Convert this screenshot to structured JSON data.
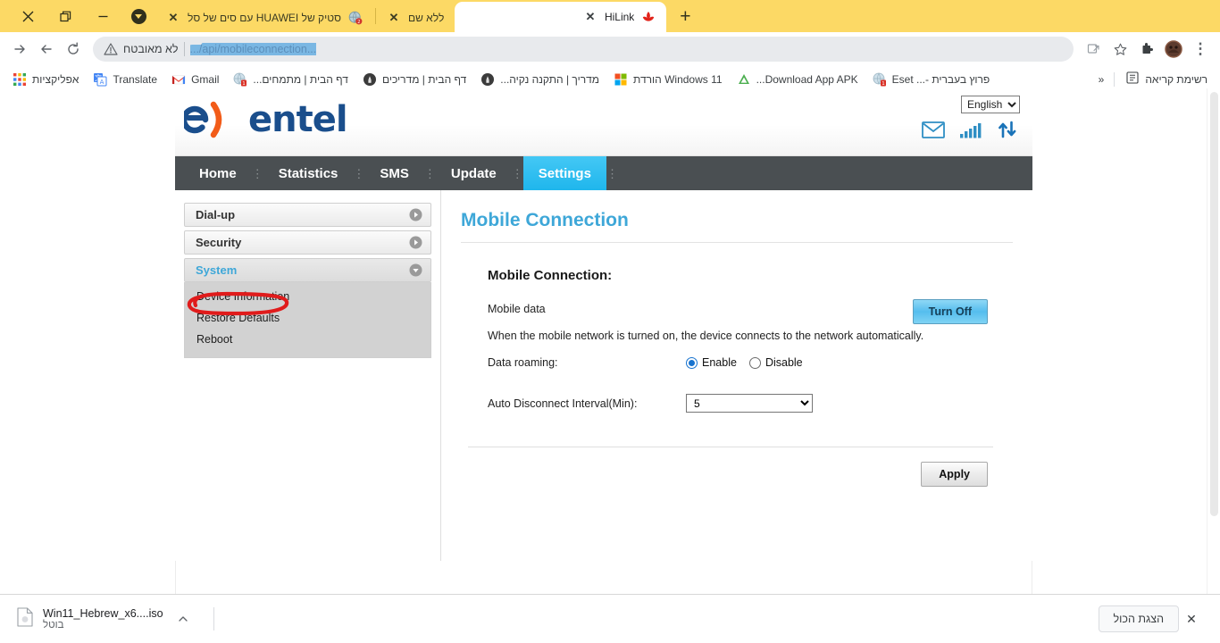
{
  "browser": {
    "window_controls": [
      {
        "name": "close-window",
        "glyph": "close"
      },
      {
        "name": "restore-window",
        "glyph": "restore"
      },
      {
        "name": "minimize-window",
        "glyph": "minimize"
      }
    ],
    "tab_search_label": "",
    "new_tab_label": "+",
    "tabs": [
      {
        "title": "HiLink",
        "active": true,
        "favicon": "huawei-petal-icon",
        "close_label": "✕"
      },
      {
        "title": "ללא שם",
        "active": false,
        "favicon": "none",
        "close_label": "✕"
      },
      {
        "title": "סטיק של HUAWEI עם סים של סל",
        "active": false,
        "favicon": "globe-badge-icon",
        "close_label": "✕"
      }
    ],
    "toolbar": {
      "forward_label": "→",
      "back_label": "←",
      "reload_label": "↻",
      "security_text": "לא מאובטח",
      "url": ".../api/mobileconnection...",
      "url_redacted": true,
      "bookmark_star": "☆",
      "extensions_label": "",
      "profile_label": "",
      "menu_label": "⋮"
    },
    "bookmarks": {
      "apps_label": "אפליקציות",
      "items": [
        {
          "label": "Translate",
          "icon": "translate-icon"
        },
        {
          "label": "Gmail",
          "icon": "gmail-icon"
        },
        {
          "label": "דף הבית | מתמחים...",
          "icon": "red-doc-icon"
        },
        {
          "label": "דף הבית | מדריכים",
          "icon": "dark-badge-icon"
        },
        {
          "label": "מדריך | התקנה נקיה...",
          "icon": "dark-badge-icon"
        },
        {
          "label": "Windows 11 הורדת",
          "icon": "windows-icon"
        },
        {
          "label": "Download App APK...",
          "icon": "apkpure-icon"
        },
        {
          "label": "פרוץ בעברית -... Eset",
          "icon": "red-doc-icon"
        }
      ],
      "overflow_label": "«",
      "reading_list_label": "רשימת קריאה"
    },
    "download_shelf": {
      "file_name": "Win11_Hebrew_x6....iso",
      "status": "בוטל",
      "file_icon": "document-icon",
      "expand_label": "∧",
      "show_all_label": "הצגת הכול",
      "close_label": "✕"
    }
  },
  "site": {
    "brand": "entel",
    "language": {
      "selected": "English",
      "options": [
        "English"
      ]
    },
    "header_icons": [
      {
        "name": "mail-icon"
      },
      {
        "name": "signal-bars-icon"
      },
      {
        "name": "data-transfer-icon"
      }
    ],
    "nav": [
      {
        "label": "Home",
        "active": false
      },
      {
        "label": "Statistics",
        "active": false
      },
      {
        "label": "SMS",
        "active": false
      },
      {
        "label": "Update",
        "active": false
      },
      {
        "label": "Settings",
        "active": true
      }
    ],
    "sidebar": [
      {
        "label": "Dial-up",
        "expanded": false,
        "children": []
      },
      {
        "label": "Security",
        "expanded": false,
        "children": []
      },
      {
        "label": "System",
        "expanded": true,
        "children": [
          {
            "label": "Device Information",
            "highlighted": false
          },
          {
            "label": "Restore Defaults",
            "highlighted": true
          },
          {
            "label": "Reboot",
            "highlighted": false
          }
        ]
      }
    ],
    "annotation": {
      "shape": "red-circle",
      "color": "#e01b1b",
      "around": "Restore Defaults"
    },
    "content": {
      "page_title": "Mobile Connection",
      "section_title": "Mobile Connection:",
      "mobile_data_label": "Mobile data",
      "turn_off_label": "Turn Off",
      "hint": "When the mobile network is turned on, the device connects to the network automatically.",
      "data_roaming_label": "Data roaming:",
      "roaming_options": [
        {
          "label": "Enable",
          "checked": true
        },
        {
          "label": "Disable",
          "checked": false
        }
      ],
      "auto_disconnect_label": "Auto Disconnect Interval(Min):",
      "auto_disconnect_value": "5",
      "auto_disconnect_options": [
        "5"
      ],
      "apply_label": "Apply"
    }
  },
  "colors": {
    "tab_strip": "#fcd965",
    "nav_bar": "#4a4f52",
    "accent_blue": "#3ea7d8",
    "brand_blue": "#1a4e8c",
    "brand_orange": "#f25c19",
    "annotation_red": "#e01b1b"
  }
}
